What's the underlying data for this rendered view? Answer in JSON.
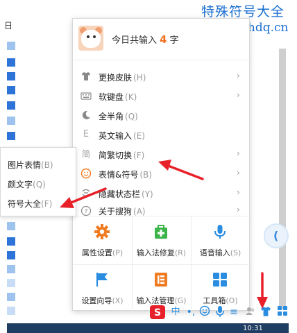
{
  "watermark": {
    "title": "特殊符号大全",
    "url": "www.tsfhdq.cn"
  },
  "background": {
    "left_text": "日"
  },
  "menu": {
    "header": {
      "prefix": "今日共输入",
      "count": "4",
      "suffix": "字"
    },
    "items": [
      {
        "label": "更换皮肤",
        "shortcut": "(H)",
        "icon": "shirt-icon",
        "has_arrow": true
      },
      {
        "label": "软键盘",
        "shortcut": "(K)",
        "icon": "keyboard-icon",
        "has_arrow": true
      },
      {
        "label": "全半角",
        "shortcut": "(Q)",
        "icon": "moon-icon",
        "has_arrow": false
      },
      {
        "label": "英文输入",
        "shortcut": "(E)",
        "icon": "english-icon",
        "has_arrow": false
      },
      {
        "label": "简繁切换",
        "shortcut": "(F)",
        "icon": "traditional-icon",
        "has_arrow": true
      },
      {
        "label": "表情&符号",
        "shortcut": "(B)",
        "icon": "smiley-icon",
        "has_arrow": true
      },
      {
        "label": "隐藏状态栏",
        "shortcut": "(Y)",
        "icon": "hide-icon",
        "has_arrow": true
      },
      {
        "label": "关于搜狗",
        "shortcut": "(A)",
        "icon": "help-icon",
        "has_arrow": true
      }
    ],
    "grid": [
      {
        "label": "属性设置",
        "shortcut": "(P)",
        "icon": "gear-icon"
      },
      {
        "label": "输入法修复",
        "shortcut": "(R)",
        "icon": "repair-icon"
      },
      {
        "label": "语音输入",
        "shortcut": "(S)",
        "icon": "microphone-icon"
      },
      {
        "label": "设置向导",
        "shortcut": "(X)",
        "icon": "flag-icon"
      },
      {
        "label": "输入法管理",
        "shortcut": "(G)",
        "icon": "manage-icon"
      },
      {
        "label": "工具箱",
        "shortcut": "(O)",
        "icon": "toolbox-icon"
      }
    ]
  },
  "submenu": {
    "items": [
      {
        "label": "图片表情",
        "shortcut": "(B)"
      },
      {
        "label": "颜文字",
        "shortcut": "(Q)"
      },
      {
        "label": "符号大全",
        "shortcut": "(F)"
      }
    ]
  },
  "taskbar": {
    "time": "10:31"
  },
  "colors": {
    "accent_orange": "#f07020",
    "arrow_red": "#e8202a",
    "watermark_blue": "#1a6fd0",
    "grid_icon_orange": "#f07a20",
    "grid_icon_green": "#3cb44a",
    "grid_icon_blue": "#2a8de0"
  }
}
